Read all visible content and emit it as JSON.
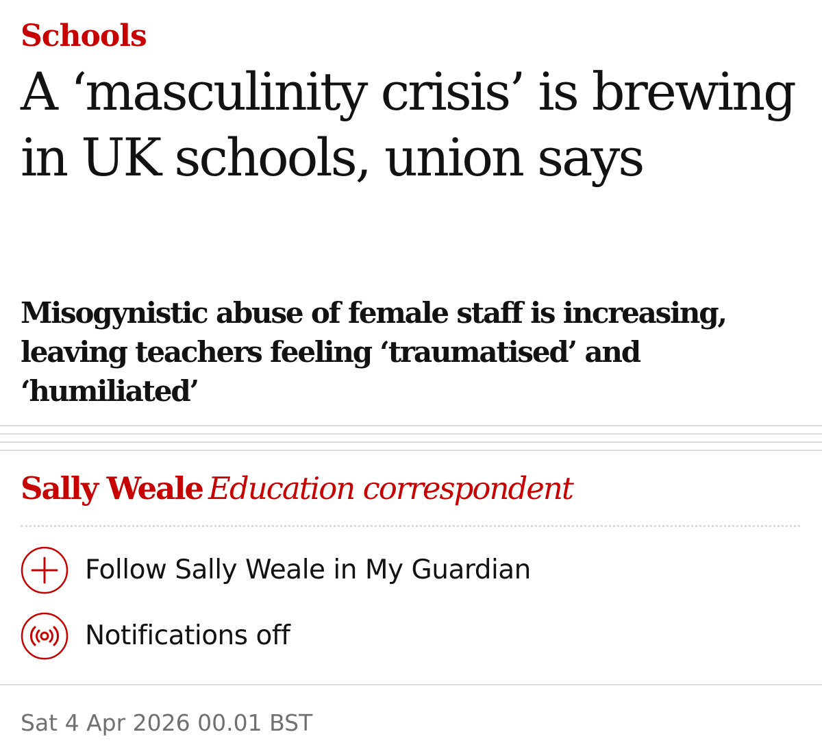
{
  "section": {
    "label": "Schools"
  },
  "headline": "A ‘masculinity crisis’ is brewing in UK schools, union says",
  "standfirst": "Misogynistic abuse of female staff is increasing, leaving teachers feeling ‘traumatised’ and ‘humiliated’",
  "byline": {
    "author": "Sally Weale",
    "role": "Education correspondent"
  },
  "actions": {
    "follow": {
      "label": "Follow Sally Weale in My Guardian",
      "icon": "plus-circle-icon"
    },
    "notifications": {
      "label": "Notifications off",
      "icon": "broadcast-icon"
    }
  },
  "dateline": "Sat 4 Apr 2026 00.01 BST",
  "colors": {
    "accent": "#c70000",
    "text": "#121212",
    "muted": "#707070",
    "rule": "#dcdcdc",
    "background": "#ffffff"
  }
}
